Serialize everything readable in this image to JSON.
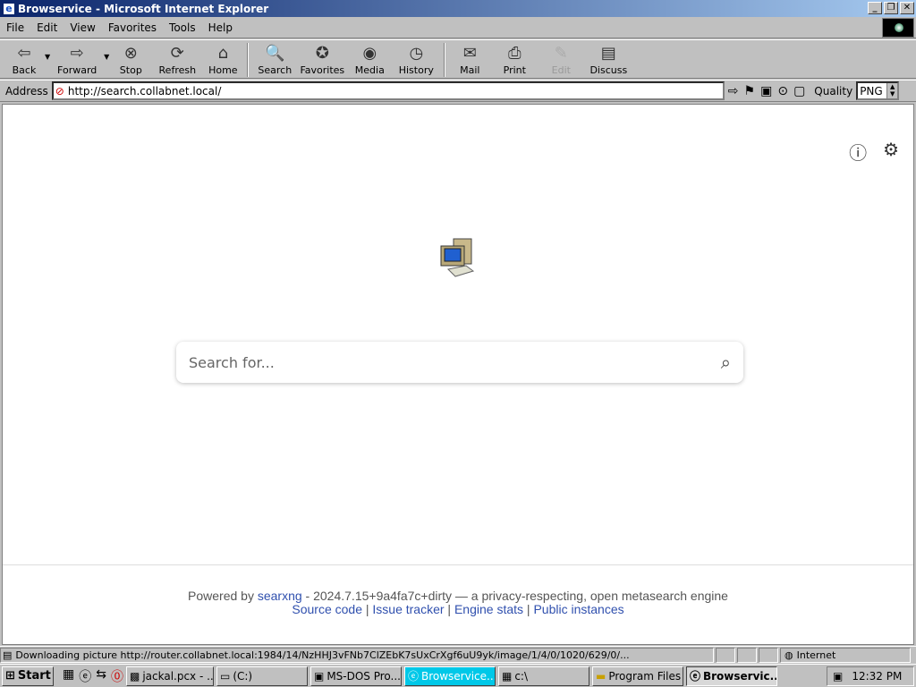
{
  "window": {
    "title": "Browservice - Microsoft Internet Explorer"
  },
  "menu": {
    "items": [
      "File",
      "Edit",
      "View",
      "Favorites",
      "Tools",
      "Help"
    ]
  },
  "toolbar": {
    "back": "Back",
    "forward": "Forward",
    "stop": "Stop",
    "refresh": "Refresh",
    "home": "Home",
    "search": "Search",
    "favorites": "Favorites",
    "media": "Media",
    "history": "History",
    "mail": "Mail",
    "print": "Print",
    "edit": "Edit",
    "discuss": "Discuss"
  },
  "address": {
    "label": "Address",
    "url": "http://search.collabnet.local/"
  },
  "quality": {
    "label": "Quality",
    "value": "PNG"
  },
  "page": {
    "search_placeholder": "Search for...",
    "footer": {
      "powered_prefix": "Powered by ",
      "engine": "searxng",
      "version_text": " - 2024.7.15+9a4fa7c+dirty — a privacy-respecting, open metasearch engine",
      "links": [
        "Source code",
        "Issue tracker",
        "Engine stats",
        "Public instances"
      ]
    }
  },
  "statusbar": {
    "message": "Downloading picture http://router.collabnet.local:1984/14/NzHHJ3vFNb7ClZEbK7sUxCrXgf6uU9yk/image/1/4/0/1020/629/0/...",
    "zone": "Internet"
  },
  "taskbar": {
    "start": "Start",
    "tasks": [
      "jackal.pcx - ...",
      "(C:)",
      "MS-DOS Pro...",
      "Browservice...",
      "c:\\",
      "Program Files",
      "Browservic..."
    ],
    "clock": "12:32 PM"
  },
  "icons": {
    "back": "arrow-left",
    "forward": "arrow-right",
    "stop": "stop-x",
    "refresh": "refresh",
    "home": "house",
    "search": "magnifier-globe",
    "favorites": "star-folder",
    "media": "media-globe",
    "history": "history-globe",
    "mail": "mail-envelope",
    "print": "printer",
    "edit": "edit-pencil",
    "discuss": "discuss-page",
    "info": "info-circle",
    "settings": "gear"
  }
}
